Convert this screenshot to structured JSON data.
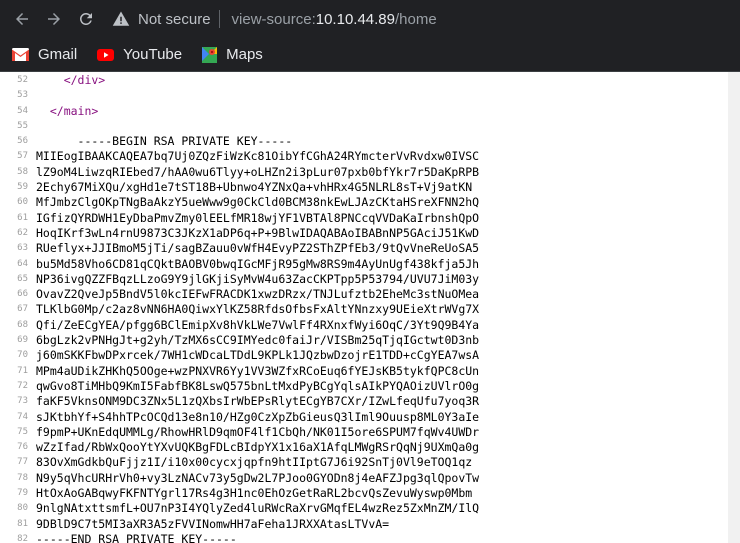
{
  "browser": {
    "not_secure": "Not secure",
    "url_scheme": "view-source:",
    "url_host": "10.10.44.89",
    "url_path": "/home"
  },
  "bookmarks": [
    {
      "label": "Gmail",
      "icon": "gmail-icon"
    },
    {
      "label": "YouTube",
      "icon": "youtube-icon"
    },
    {
      "label": "Maps",
      "icon": "maps-icon"
    }
  ],
  "source_lines": [
    {
      "num": "52",
      "text": "    </div>",
      "kind": "tag"
    },
    {
      "num": "53",
      "text": "",
      "kind": "plain"
    },
    {
      "num": "54",
      "text": "  </main>",
      "kind": "tag"
    },
    {
      "num": "55",
      "text": "",
      "kind": "plain"
    },
    {
      "num": "56",
      "text": "      -----BEGIN RSA PRIVATE KEY-----",
      "kind": "plain"
    },
    {
      "num": "57",
      "text": "MIIEogIBAAKCAQEA7bq7Uj0ZQzFiWzKc81OibYfCGhA24RYmcterVvRvdxw0IVSC",
      "kind": "plain"
    },
    {
      "num": "58",
      "text": "lZ9oM4LiwzqRIEbed7/hAA0wu6Tlyy+oLHZn2i3pLur07pxb0bfYkr7r5DaKpRPB",
      "kind": "plain"
    },
    {
      "num": "59",
      "text": "2Echy67MiXQu/xgHd1e7tST18B+Ubnwo4YZNxQa+vhHRx4G5NLRL8sT+Vj9atKN",
      "kind": "plain"
    },
    {
      "num": "60",
      "text": "MfJmbzClgOKpTNgBaAkzY5ueWww9g0CkCld0BCM38nkEwLJAzCKtaHSreXFNN2hQ",
      "kind": "plain"
    },
    {
      "num": "61",
      "text": "IGfizQYRDWH1EyDbaPmvZmy0lEELfMR18wjYF1VBTAl8PNCcqVVDaKaIrbnshQpO",
      "kind": "plain"
    },
    {
      "num": "62",
      "text": "HoqIKrf3wLn4rnU9873C3JKzX1aDP6q+P+9BlwIDAQABAoIBABnNP5GAciJ51KwD",
      "kind": "plain"
    },
    {
      "num": "63",
      "text": "RUeflyx+JJIBmoM5jTi/sagBZauu0vWfH4EvyPZ2SThZPfEb3/9tQvVneReUoSA5",
      "kind": "plain"
    },
    {
      "num": "64",
      "text": "bu5Md58Vho6CD81qCQktBAOBV0bwqIGcMFjR95gMw8RS9m4AyUnUgf438kfja5Jh",
      "kind": "plain"
    },
    {
      "num": "65",
      "text": "NP36ivgQZZFBqzLLzoG9Y9jlGKjiSyMvW4u63ZacCKPTpp5P53794/UVU7JiM03y",
      "kind": "plain"
    },
    {
      "num": "66",
      "text": "OvavZ2QveJp5BndV5l0kcIEFwFRACDK1xwzDRzx/TNJLufztb2EheMc3stNuOMea",
      "kind": "plain"
    },
    {
      "num": "67",
      "text": "TLKlbG0Mp/c2az8vNN6HA0QiwxYlKZ58RfdsOfbsFxAltYNnzxy9UEieXtrWVg7X",
      "kind": "plain"
    },
    {
      "num": "68",
      "text": "Qfi/ZeECgYEA/pfgg6BClEmipXv8hVkLWe7VwlFf4RXnxfWyi6OqC/3Yt9Q9B4Ya",
      "kind": "plain"
    },
    {
      "num": "69",
      "text": "6bgLzk2vPNHgJt+g2yh/TzMX6sCC9IMYedc0faiJr/VISBm25qTjqIGctwt0D3nb",
      "kind": "plain"
    },
    {
      "num": "70",
      "text": "j60mSKKFbwDPxrcek/7WH1cWDcaLTDdL9KPLk1JQzbwDzojrE1TDD+cCgYEA7wsA",
      "kind": "plain"
    },
    {
      "num": "71",
      "text": "MPm4aUDikZHKhQ5OOge+wzPNXVR6Yy1VV3WZfxRCoEuq6fYEJsKB5tykfQPC8cUn",
      "kind": "plain"
    },
    {
      "num": "72",
      "text": "qwGvo8TiMHbQ9KmI5FabfBK8LswQ575bnLtMxdPyBCgYqlsAIkPYQAOizUVlrO0g",
      "kind": "plain"
    },
    {
      "num": "73",
      "text": "faKF5VknsONM9DC3ZNx5L1zQXbsIrWbEPsRlytECgYB7CXr/IZwLfeqUfu7yoq3R",
      "kind": "plain"
    },
    {
      "num": "74",
      "text": "sJKtbhYf+S4hhTPcOCQd13e8n10/HZg0CzXpZbGieusQ3lIml9Ouusp8ML0Y3aIe",
      "kind": "plain"
    },
    {
      "num": "75",
      "text": "f9pmP+UKnEdqUMMLg/RhowHRlD9qmOF4lf1CbQh/NK01I5ore6SPUM7fqWv4UWDr",
      "kind": "plain"
    },
    {
      "num": "76",
      "text": "wZzIfad/RbWxQooYtYXvUQKBgFDLcBIdpYX1x16aX1AfqLMWgRSrQqNj9UXmQa0g",
      "kind": "plain"
    },
    {
      "num": "77",
      "text": "83OvXmGdkbQuFjjz1I/i10x00cycxjqpfn9htIIptG7J6i92SnTj0Vl9eTOQ1qz",
      "kind": "plain"
    },
    {
      "num": "78",
      "text": "N9y5qVhcURHrVh0+vy3LzNACv73y5gDw2L7PJoo0GYODn8j4eAFZJpg3qlQpovTw",
      "kind": "plain"
    },
    {
      "num": "79",
      "text": "HtOxAoGABqwyFKFNTYgrl17Rs4g3H1nc0EhOzGetRaRL2bcvQsZevuWyswp0Mbm",
      "kind": "plain"
    },
    {
      "num": "80",
      "text": "9nlgNAtxttsmfL+OU7nP3I4YQlyZed4luRWcRaXrvGMqfEL4wzRez5ZxMnZM/IlQ",
      "kind": "plain"
    },
    {
      "num": "81",
      "text": "9DBlD9C7t5MI3aXR3A5zFVVINomwHH7aFeha1JRXXAtasLTVvA=",
      "kind": "plain"
    },
    {
      "num": "82",
      "text": "-----END RSA PRIVATE KEY-----",
      "kind": "plain"
    },
    {
      "num": "83",
      "text": "",
      "kind": "plain"
    }
  ]
}
